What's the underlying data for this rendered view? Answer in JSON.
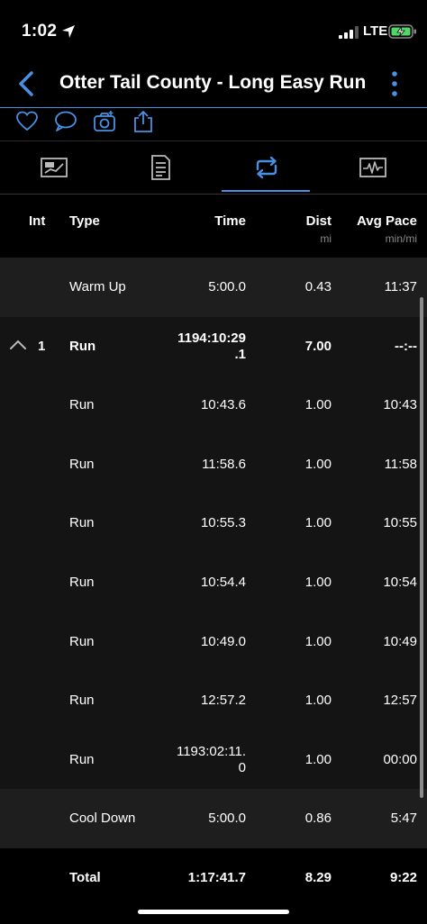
{
  "status_bar": {
    "time": "1:02",
    "network": "LTE"
  },
  "nav": {
    "title": "Otter Tail County - Long Easy Run"
  },
  "table": {
    "headers": {
      "int": "Int",
      "type": "Type",
      "time": "Time",
      "dist": "Dist",
      "dist_unit": "mi",
      "pace": "Avg Pace",
      "pace_unit": "min/mi"
    },
    "rows": [
      {
        "int": "",
        "type": "Warm Up",
        "time": "5:00.0",
        "dist": "0.43",
        "pace": "11:37"
      },
      {
        "int": "1",
        "type": "Run",
        "time": "1194:10:29\n.1",
        "dist": "7.00",
        "pace": "--:--"
      },
      {
        "int": "",
        "type": "Run",
        "time": "10:43.6",
        "dist": "1.00",
        "pace": "10:43"
      },
      {
        "int": "",
        "type": "Run",
        "time": "11:58.6",
        "dist": "1.00",
        "pace": "11:58"
      },
      {
        "int": "",
        "type": "Run",
        "time": "10:55.3",
        "dist": "1.00",
        "pace": "10:55"
      },
      {
        "int": "",
        "type": "Run",
        "time": "10:54.4",
        "dist": "1.00",
        "pace": "10:54"
      },
      {
        "int": "",
        "type": "Run",
        "time": "10:49.0",
        "dist": "1.00",
        "pace": "10:49"
      },
      {
        "int": "",
        "type": "Run",
        "time": "12:57.2",
        "dist": "1.00",
        "pace": "12:57"
      },
      {
        "int": "",
        "type": "Run",
        "time": "1193:02:11.\n0",
        "dist": "1.00",
        "pace": "00:00"
      },
      {
        "int": "",
        "type": "Cool Down",
        "time": "5:00.0",
        "dist": "0.86",
        "pace": "5:47"
      }
    ],
    "total": {
      "type": "Total",
      "time": "1:17:41.7",
      "dist": "8.29",
      "pace": "9:22"
    }
  },
  "colors": {
    "accent": "#4a90e2",
    "battery": "#4cd964"
  }
}
